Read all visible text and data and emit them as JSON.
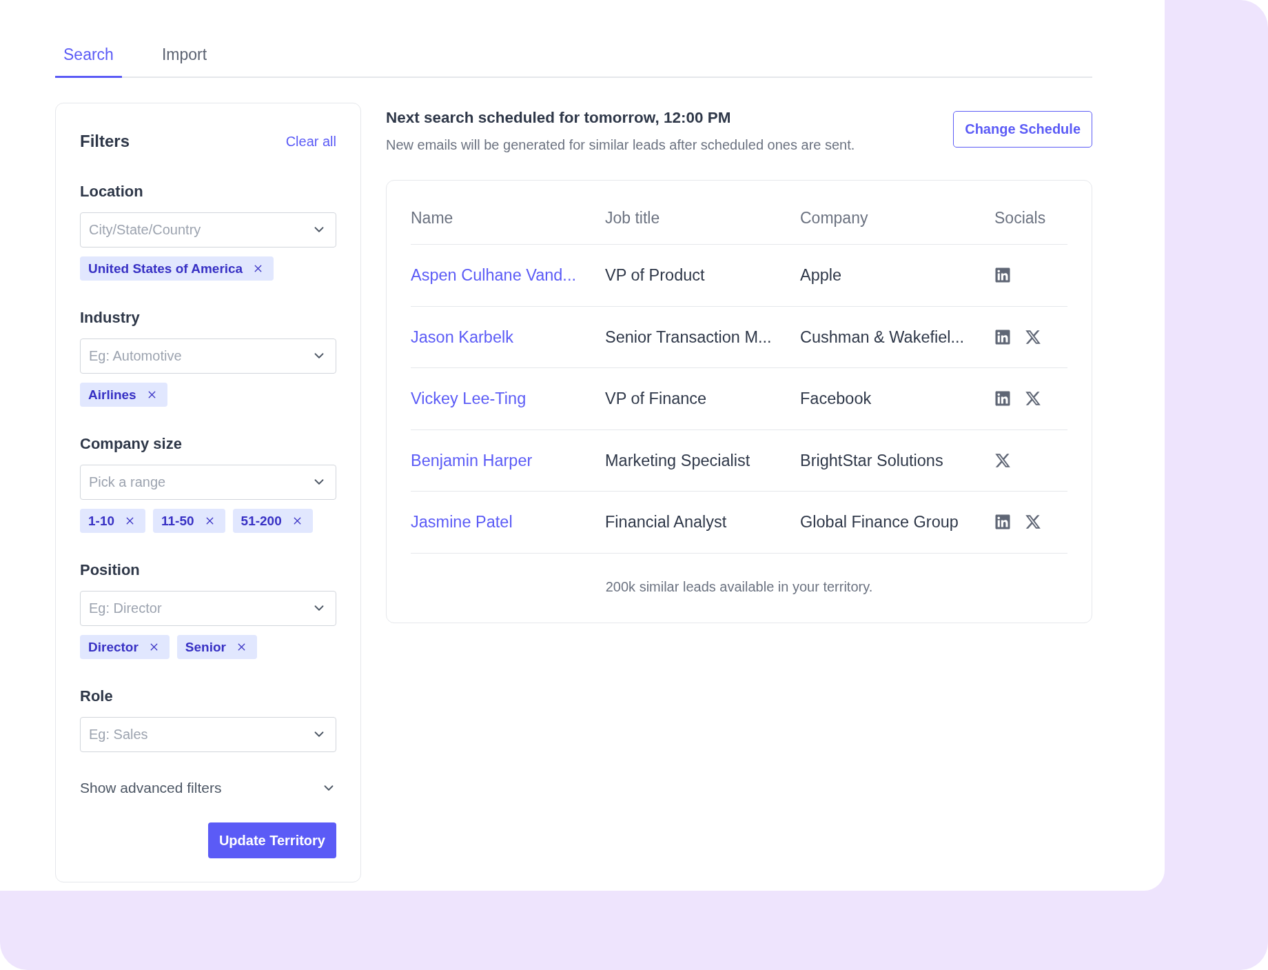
{
  "tabs": [
    {
      "label": "Search",
      "selected": true
    },
    {
      "label": "Import",
      "selected": false
    }
  ],
  "filters": {
    "title": "Filters",
    "clear_link": "Clear all",
    "groups": [
      {
        "label": "Location",
        "placeholder": "City/State/Country",
        "chips": [
          "United States of America"
        ]
      },
      {
        "label": "Industry",
        "placeholder": "Eg: Automotive",
        "chips": [
          "Airlines"
        ]
      },
      {
        "label": "Company size",
        "placeholder": "Pick a range",
        "chips": [
          "1-10",
          "11-50",
          "51-200"
        ]
      },
      {
        "label": "Position",
        "placeholder": "Eg: Director",
        "chips": [
          "Director",
          "Senior"
        ]
      },
      {
        "label": "Role",
        "placeholder": "Eg: Sales"
      }
    ],
    "advanced_toggle": "Show advanced filters",
    "submit_button": "Update Territory"
  },
  "schedule": {
    "title": "Next search scheduled for tomorrow, 12:00 PM",
    "subtitle": "New emails will be generated for similar leads after scheduled ones are sent.",
    "button": "Change Schedule"
  },
  "table": {
    "columns": [
      "Name",
      "Job title",
      "Company",
      "Socials"
    ],
    "rows": [
      {
        "name": "Aspen Culhane Vand...",
        "job_title": "VP of Product",
        "company": "Apple",
        "socials": [
          {
            "kind": "linkedin"
          }
        ]
      },
      {
        "name": "Jason Karbelk",
        "job_title": "Senior Transaction M...",
        "company": "Cushman & Wakefiel...",
        "socials": [
          {
            "kind": "linkedin"
          },
          {
            "kind": "x"
          }
        ]
      },
      {
        "name": "Vickey Lee-Ting",
        "job_title": "VP of Finance",
        "company": "Facebook",
        "socials": [
          {
            "kind": "linkedin"
          },
          {
            "kind": "x"
          }
        ]
      },
      {
        "name": "Benjamin Harper",
        "job_title": "Marketing Specialist",
        "company": "BrightStar Solutions",
        "socials": [
          {
            "kind": "x"
          }
        ]
      },
      {
        "name": "Jasmine Patel",
        "job_title": "Financial Analyst",
        "company": "Global Finance Group",
        "socials": [
          {
            "kind": "linkedin"
          },
          {
            "kind": "x"
          }
        ]
      }
    ],
    "footer": "200k similar leads available in your territory."
  }
}
